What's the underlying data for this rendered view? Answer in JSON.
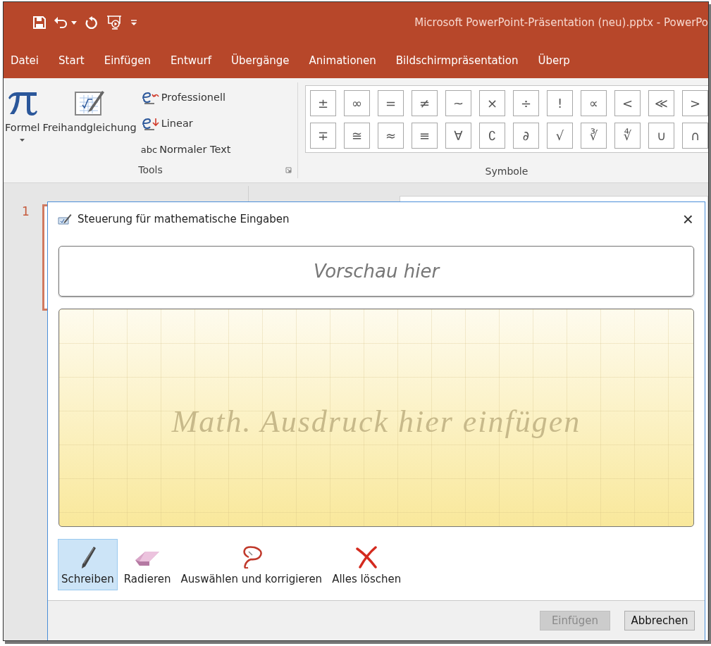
{
  "window": {
    "title": "Microsoft PowerPoint-Präsentation (neu).pptx  -  PowerPo"
  },
  "tabs": [
    {
      "label": "Datei"
    },
    {
      "label": "Start"
    },
    {
      "label": "Einfügen"
    },
    {
      "label": "Entwurf"
    },
    {
      "label": "Übergänge"
    },
    {
      "label": "Animationen"
    },
    {
      "label": "Bildschirmpräsentation"
    },
    {
      "label": "Überp"
    }
  ],
  "ribbon": {
    "tools_group": {
      "label": "Tools",
      "formula_button": "Formel",
      "ink_button": "Freihandgleichung",
      "options": [
        {
          "kind": "professional",
          "label": "Professionell"
        },
        {
          "kind": "linear",
          "label": "Linear"
        },
        {
          "kind": "text",
          "icon_text": "abc",
          "label": "Normaler Text"
        }
      ]
    },
    "symbols_group": {
      "label": "Symbole",
      "rows": [
        [
          "±",
          "∞",
          "=",
          "≠",
          "~",
          "×",
          "÷",
          "!",
          "∝",
          "<",
          "≪",
          ">"
        ],
        [
          "∓",
          "≅",
          "≈",
          "≡",
          "∀",
          "∁",
          "∂",
          "√",
          "∛",
          "∜",
          "∪",
          "∩"
        ]
      ]
    }
  },
  "slides": [
    {
      "number": "1"
    }
  ],
  "dialog": {
    "title": "Steuerung für mathematische Eingaben",
    "close": "×",
    "preview_placeholder": "Vorschau hier",
    "canvas_placeholder": "Math. Ausdruck hier einfügen",
    "tools": [
      {
        "kind": "write",
        "label": "Schreiben",
        "selected": true
      },
      {
        "kind": "erase",
        "label": "Radieren",
        "selected": false
      },
      {
        "kind": "select",
        "label": "Auswählen und korrigieren",
        "selected": false
      },
      {
        "kind": "clear",
        "label": "Alles löschen",
        "selected": false
      }
    ],
    "buttons": [
      {
        "label": "Einfügen",
        "disabled": true
      },
      {
        "label": "Abbrechen",
        "disabled": false
      }
    ]
  }
}
